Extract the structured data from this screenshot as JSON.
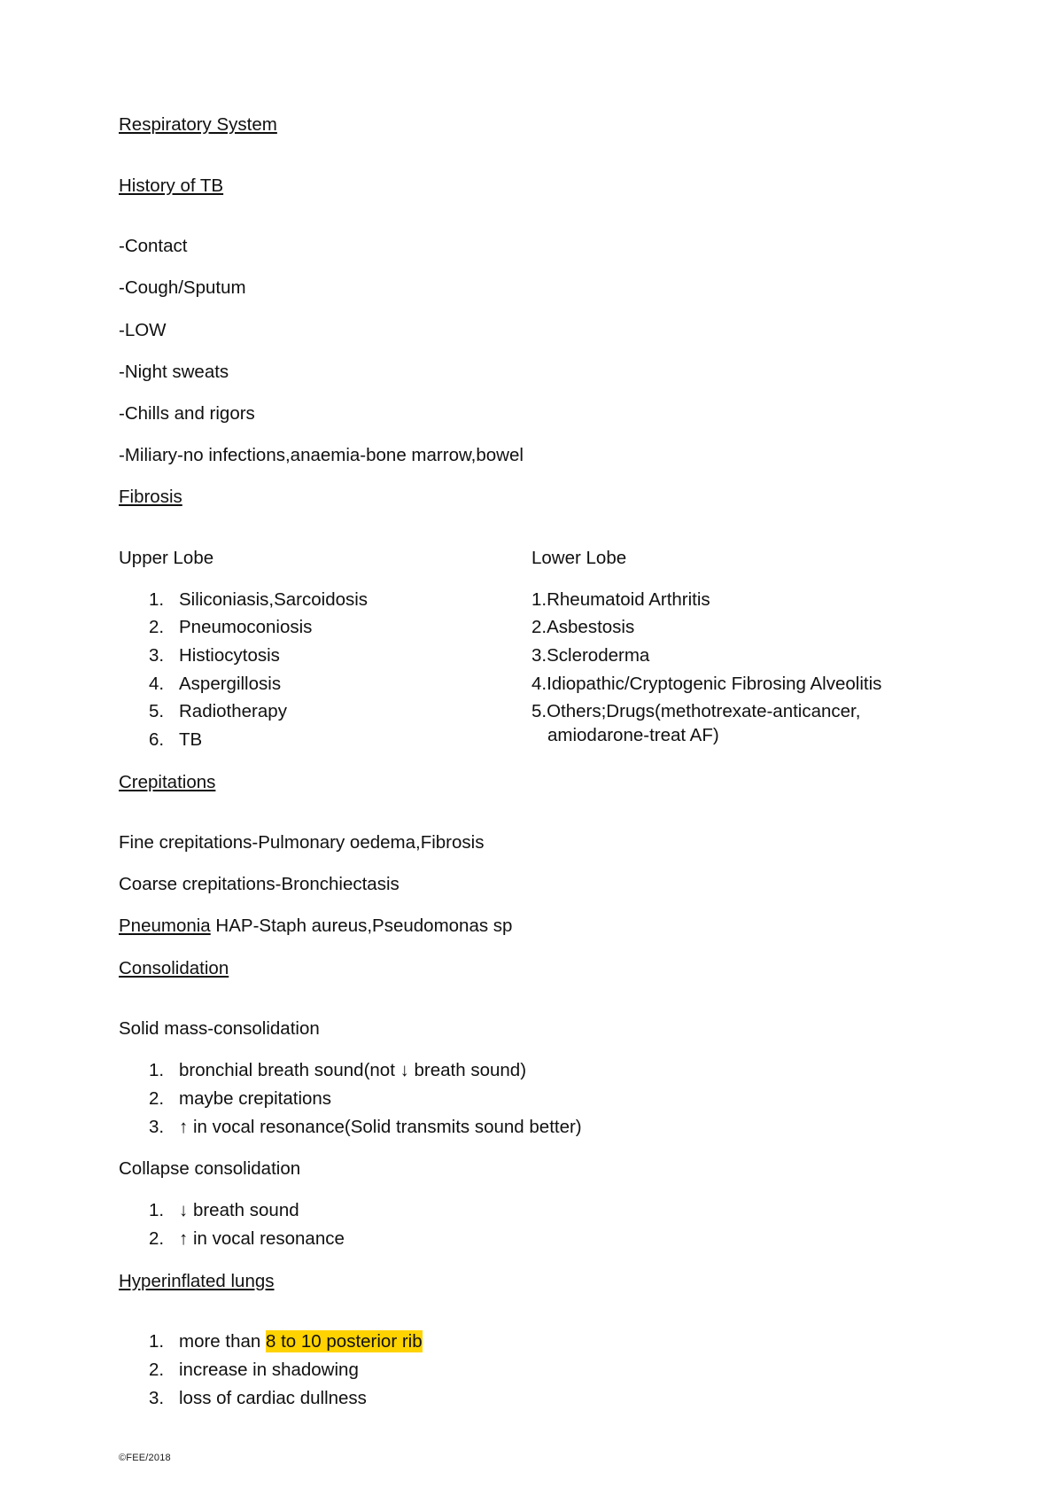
{
  "document": {
    "title": "Respiratory System",
    "sections": {
      "history_tb": {
        "heading": "History of TB",
        "items": [
          "-Contact",
          "-Cough/Sputum",
          "-LOW",
          "-Night sweats",
          "-Chills and rigors",
          "-Miliary-no infections,anaemia-bone marrow,bowel"
        ]
      },
      "fibrosis": {
        "heading": "Fibrosis",
        "left_column": {
          "heading": "Upper Lobe",
          "items": [
            "Siliconiasis,Sarcoidosis",
            "Pneumoconiosis",
            "Histiocytosis",
            "Aspergillosis",
            "Radiotherapy",
            "TB"
          ]
        },
        "right_column": {
          "heading": "Lower Lobe",
          "items": [
            "1.Rheumatoid Arthritis",
            "2.Asbestosis",
            "3.Scleroderma",
            "4.Idiopathic/Cryptogenic Fibrosing Alveolitis",
            "5.Others;Drugs(methotrexate-anticancer, amiodarone-treat AF)"
          ]
        }
      },
      "crepitations": {
        "heading": "Crepitations",
        "lines": [
          "Fine crepitations-Pulmonary oedema,Fibrosis",
          "Coarse crepitations-Bronchiectasis"
        ],
        "pneumonia_label": "Pneumonia",
        "pneumonia_text": " HAP-Staph aureus,Pseudomonas sp"
      },
      "consolidation": {
        "heading": "Consolidation",
        "solid_mass_label": "Solid mass-consolidation",
        "solid_mass_items": [
          "bronchial breath sound(not ↓ breath sound)",
          "maybe crepitations",
          "↑ in vocal resonance(Solid transmits sound better)"
        ],
        "collapse_label": "Collapse consolidation",
        "collapse_items": [
          "↓ breath sound",
          "↑ in vocal resonance"
        ]
      },
      "hyperinflated": {
        "heading": "Hyperinflated lungs",
        "item1_prefix": "more than ",
        "item1_highlight": "8 to 10 posterior rib",
        "item2": "increase in shadowing",
        "item3": "loss of cardiac dullness"
      }
    },
    "footer": "©FEE/2018",
    "highlight_color": "#ffd300"
  }
}
